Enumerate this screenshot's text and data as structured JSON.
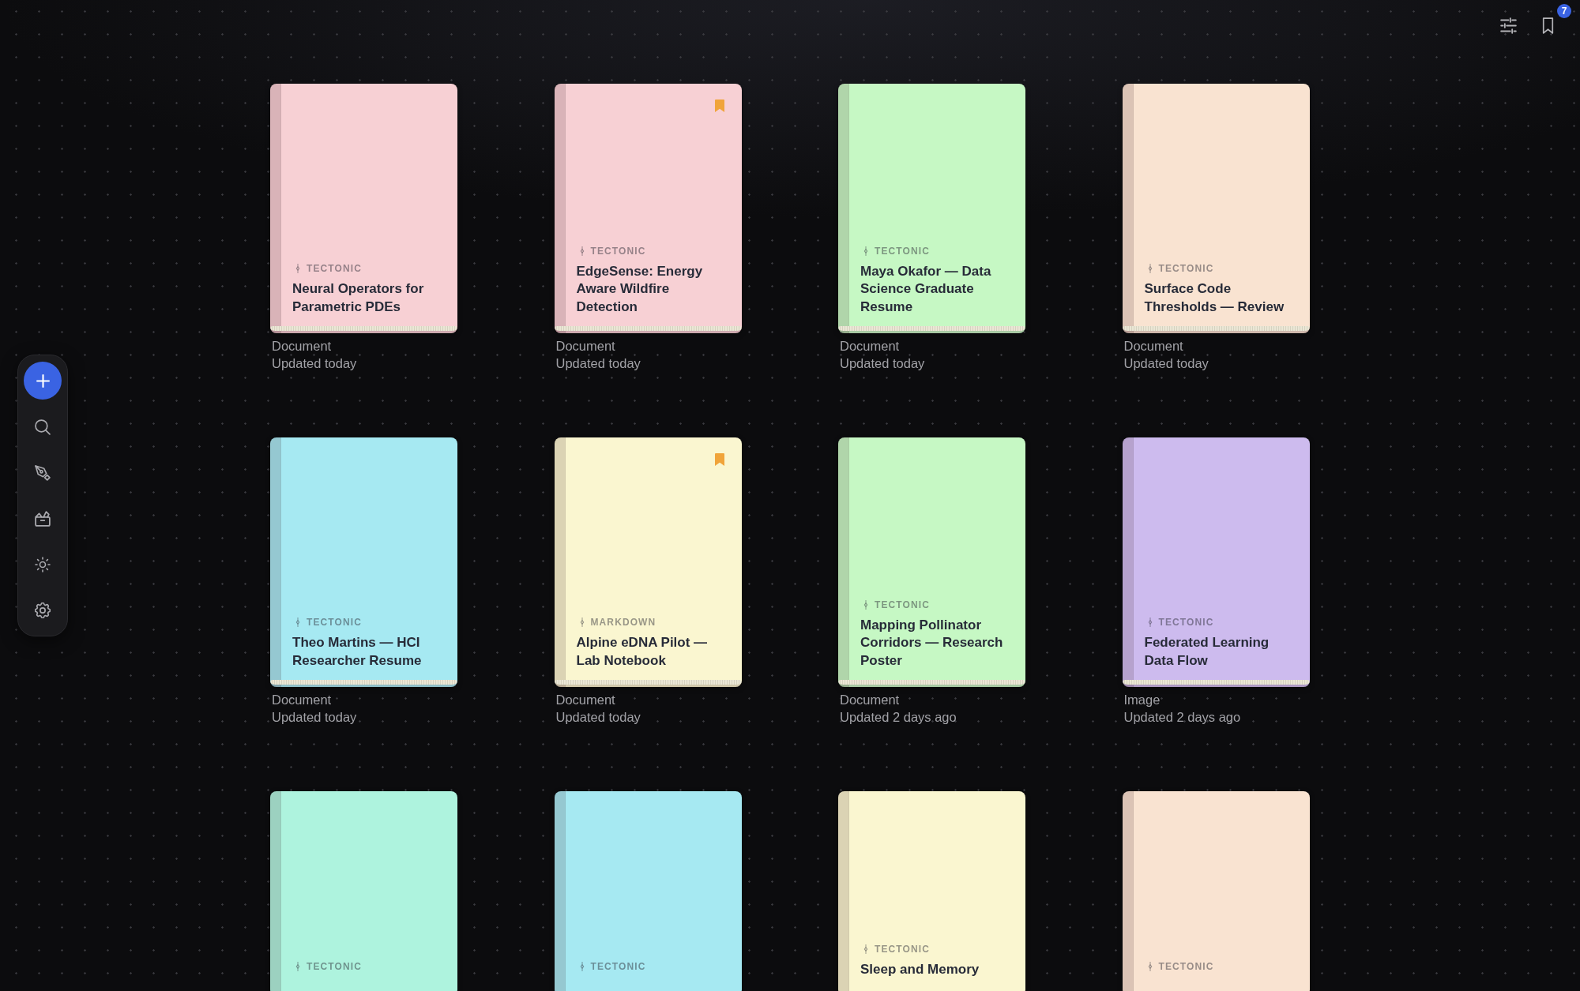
{
  "toolbar": {
    "bookmark_count": "7"
  },
  "cards": [
    {
      "format": "TECTONIC",
      "title": "Neural Operators for Parametric PDEs",
      "color": "#f7d0d4",
      "bookmarked": false,
      "type": "Document",
      "updated": "Updated today"
    },
    {
      "format": "TECTONIC",
      "title": "EdgeSense: Energy Aware Wildfire Detection",
      "color": "#f7d0d4",
      "bookmarked": true,
      "type": "Document",
      "updated": "Updated today"
    },
    {
      "format": "TECTONIC",
      "title": "Maya Okafor — Data Science Graduate Resume",
      "color": "#c6f8c4",
      "bookmarked": false,
      "type": "Document",
      "updated": "Updated today"
    },
    {
      "format": "TECTONIC",
      "title": "Surface Code Thresholds — Review",
      "color": "#f9e3d1",
      "bookmarked": false,
      "type": "Document",
      "updated": "Updated today"
    },
    {
      "format": "TECTONIC",
      "title": "Theo Martins — HCI Researcher Resume",
      "color": "#a6e9f2",
      "bookmarked": false,
      "type": "Document",
      "updated": "Updated today"
    },
    {
      "format": "MARKDOWN",
      "title": "Alpine eDNA Pilot — Lab Notebook",
      "color": "#faf6d0",
      "bookmarked": true,
      "type": "Document",
      "updated": "Updated today"
    },
    {
      "format": "TECTONIC",
      "title": "Mapping Pollinator Corridors — Research Poster",
      "color": "#c6f8c4",
      "bookmarked": false,
      "type": "Document",
      "updated": "Updated 2 days ago"
    },
    {
      "format": "TECTONIC",
      "title": "Federated Learning Data Flow",
      "color": "#cdbbee",
      "bookmarked": false,
      "type": "Image",
      "updated": "Updated 2 days ago"
    },
    {
      "format": "TECTONIC",
      "color": "#aef3de",
      "bookmarked": false
    },
    {
      "format": "TECTONIC",
      "color": "#a6e9f2",
      "bookmarked": false
    },
    {
      "format": "TECTONIC",
      "title": "Sleep and Memory",
      "color": "#faf6d0",
      "bookmarked": false
    },
    {
      "format": "TECTONIC",
      "color": "#f9e3d1",
      "bookmarked": false
    }
  ]
}
